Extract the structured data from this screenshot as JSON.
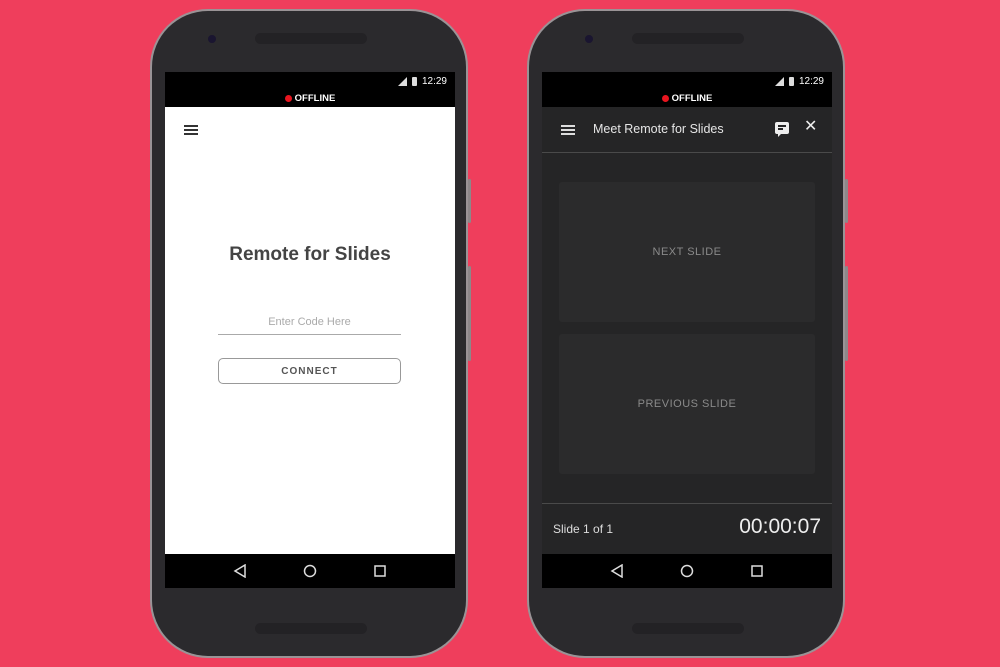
{
  "colors": {
    "background": "#ef3e5c",
    "phone_body": "#2b2a2d",
    "offline_dot": "#e8151f",
    "dark_screen": "#252526",
    "slide_button": "#2b2b2c"
  },
  "status_bar": {
    "time": "12:29",
    "signal_icon": "signal-icon",
    "battery_icon": "battery-icon",
    "offline_label": "OFFLINE"
  },
  "left_screen": {
    "menu_icon": "hamburger-menu-icon",
    "title": "Remote for Slides",
    "code_input": {
      "value": "",
      "placeholder": "Enter Code Here"
    },
    "connect_label": "CONNECT"
  },
  "right_screen": {
    "menu_icon": "hamburger-menu-icon",
    "presentation_title": "Meet Remote for Slides",
    "notes_icon": "speaker-notes-icon",
    "close_icon": "close-icon",
    "next_label": "NEXT SLIDE",
    "previous_label": "PREVIOUS SLIDE",
    "slide_counter": "Slide 1 of 1",
    "timer": "00:00:07"
  },
  "nav_bar": {
    "back_icon": "back-icon",
    "home_icon": "home-icon",
    "recents_icon": "recents-icon"
  }
}
